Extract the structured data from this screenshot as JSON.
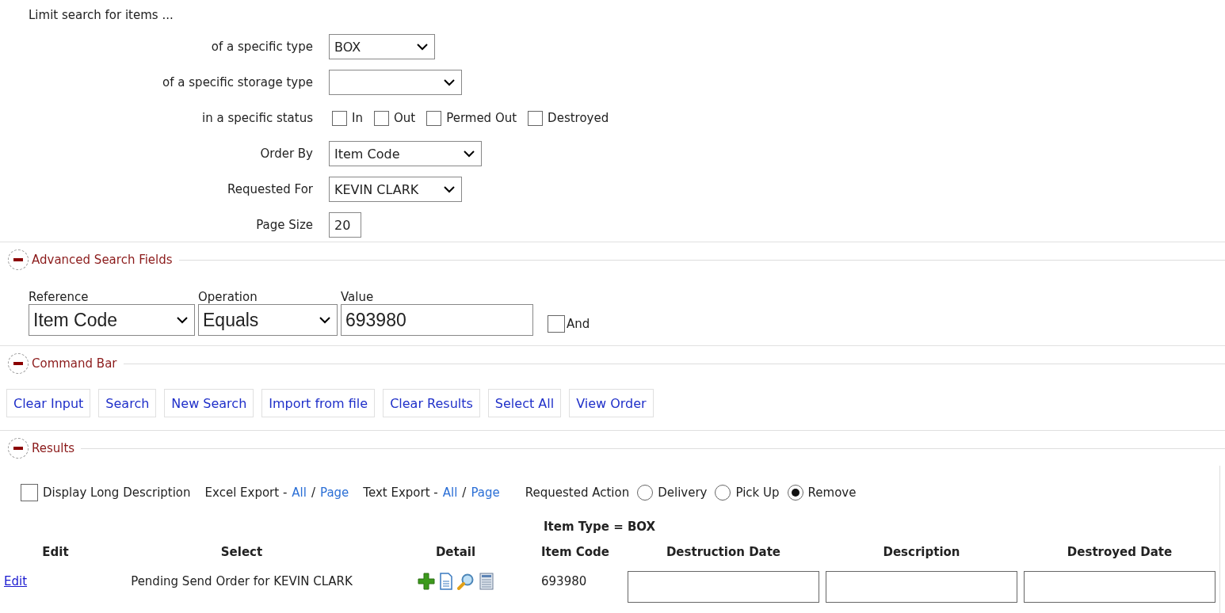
{
  "filters": {
    "title": "Limit search for items ...",
    "rows": [
      {
        "label": "of a specific type",
        "kind": "select",
        "value": "BOX"
      },
      {
        "label": "of a specific storage type",
        "kind": "select"
      },
      {
        "label": "in a specific status",
        "kind": "checks",
        "options": [
          {
            "label": "In",
            "checked": false
          },
          {
            "label": "Out",
            "checked": false
          },
          {
            "label": "Permed Out",
            "checked": false
          },
          {
            "label": "Destroyed",
            "checked": false
          }
        ]
      },
      {
        "label": "Order By",
        "kind": "select",
        "value": "Item Code"
      },
      {
        "label": "Requested For",
        "kind": "select",
        "value": "KEVIN CLARK"
      },
      {
        "label": "Page Size",
        "kind": "text",
        "value": "20"
      }
    ]
  },
  "advanced_search": {
    "title": "Advanced Search Fields",
    "expanded": true,
    "fields": [
      {
        "label": "Reference",
        "kind": "select",
        "value": "Item Code"
      },
      {
        "label": "Operation",
        "kind": "select",
        "value": "Equals"
      },
      {
        "label": "Value",
        "kind": "text",
        "value": "693980"
      }
    ],
    "and": {
      "label": "And",
      "checked": false
    }
  },
  "command_bar": {
    "title": "Command Bar",
    "expanded": true,
    "buttons": [
      "Clear Input",
      "Search",
      "New Search",
      "Import from file",
      "Clear Results",
      "Select All",
      "View Order"
    ]
  },
  "results": {
    "title": "Results",
    "expanded": true,
    "display_long_description": {
      "label": "Display Long Description",
      "checked": false
    },
    "exports": [
      {
        "label": "Excel Export -",
        "links": [
          "All",
          "Page"
        ],
        "separator": "/"
      },
      {
        "label": "Text Export -",
        "links": [
          "All",
          "Page"
        ],
        "separator": "/"
      }
    ],
    "requested_action": {
      "label": "Requested Action",
      "options": [
        {
          "label": "Delivery",
          "selected": false
        },
        {
          "label": "Pick Up",
          "selected": false
        },
        {
          "label": "Remove",
          "selected": true
        }
      ]
    },
    "group_heading": "Item Type = BOX",
    "columns": [
      {
        "label": "Edit",
        "kind": "edit"
      },
      {
        "label": "Select",
        "kind": "select"
      },
      {
        "label": "Detail",
        "kind": "detail"
      },
      {
        "label": "Item Code",
        "kind": "item_code"
      },
      {
        "label": "Destruction Date",
        "kind": "input"
      },
      {
        "label": "Description",
        "kind": "input"
      },
      {
        "label": "Destroyed Date",
        "kind": "input"
      }
    ],
    "rows": [
      {
        "edit": "Edit",
        "select": "Pending Send Order for KEVIN CLARK",
        "item_code": "693980"
      }
    ]
  }
}
